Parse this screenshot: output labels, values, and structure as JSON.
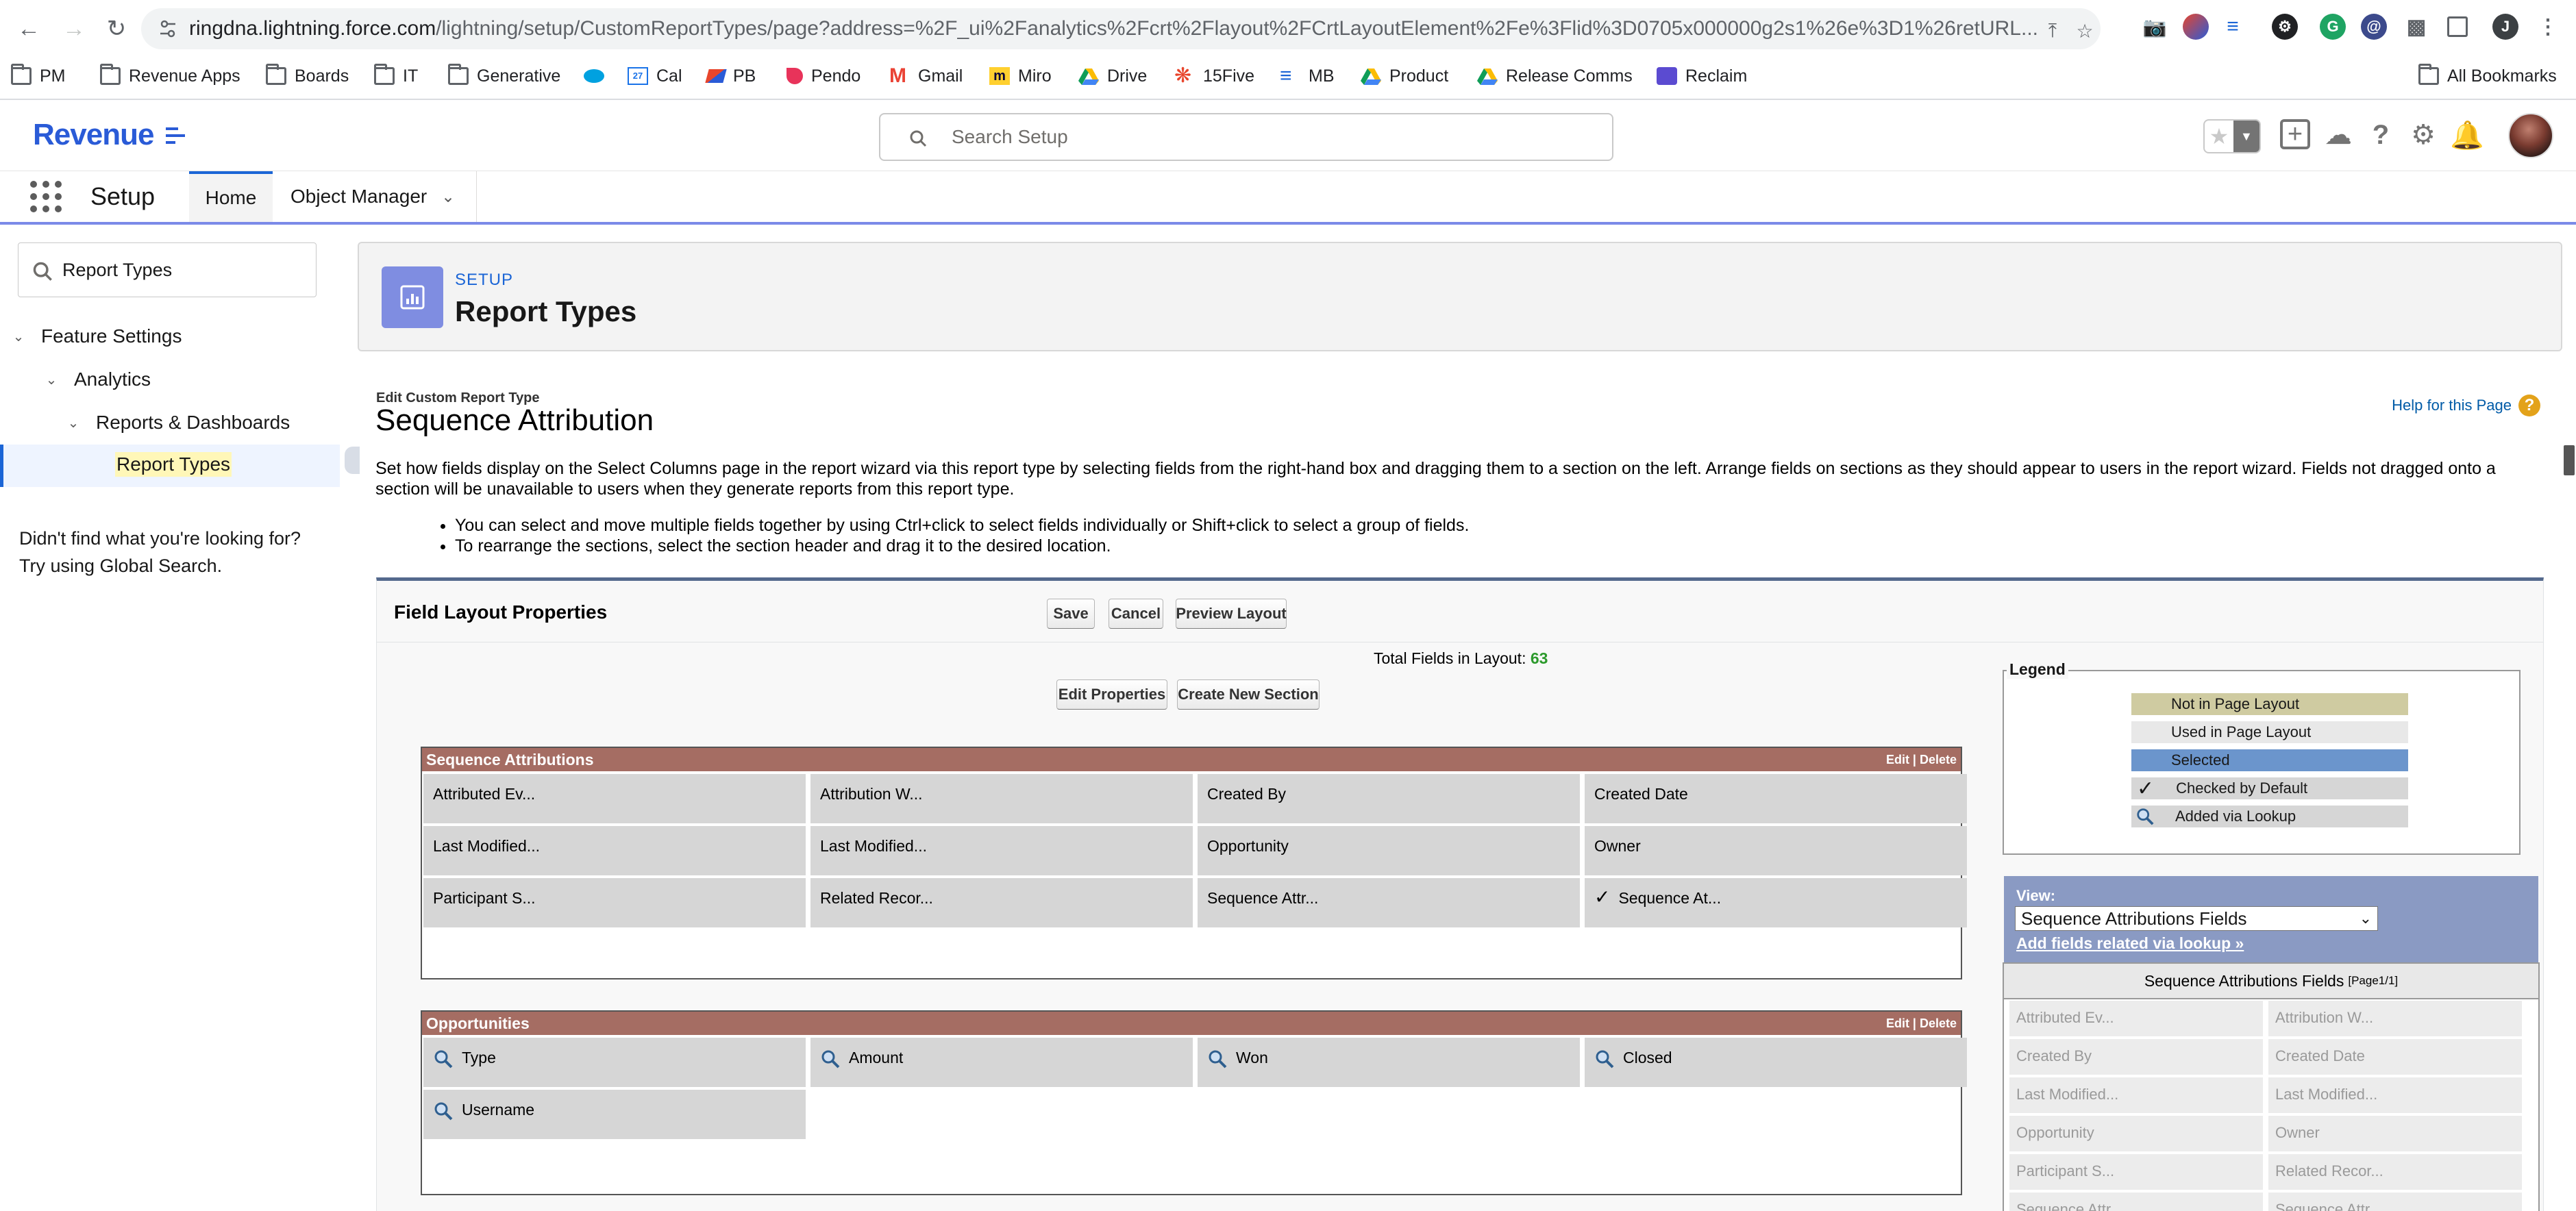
{
  "browser": {
    "url_host": "ringdna.lightning.force.com",
    "url_path": "/lightning/setup/CustomReportTypes/page?address=%2F_ui%2Fanalytics%2Fcrt%2Flayout%2FCrtLayoutElement%2Fe%3Flid%3D0705x000000g2s1%26e%3D1%26retURL...",
    "profile_initial": "J",
    "bookmarks": [
      "PM",
      "Revenue Apps",
      "Boards",
      "IT",
      "Generative",
      "Cal",
      "PB",
      "Pendo",
      "Gmail",
      "Miro",
      "Drive",
      "15Five",
      "MB",
      "Product",
      "Release Comms",
      "Reclaim"
    ],
    "all_bookmarks": "All Bookmarks",
    "cal_badge": "27"
  },
  "sf": {
    "logo": "Revenue",
    "search_placeholder": "Search Setup",
    "app_name": "Setup",
    "tabs": {
      "home": "Home",
      "object_manager": "Object Manager"
    }
  },
  "sidebar": {
    "quickfind_value": "Report Types",
    "tree": [
      "Feature Settings",
      "Analytics",
      "Reports & Dashboards",
      "Report Types"
    ],
    "not_found_line1": "Didn't find what you're looking for?",
    "not_found_line2": "Try using Global Search."
  },
  "page_header": {
    "eyebrow": "SETUP",
    "title": "Report Types"
  },
  "content": {
    "edit_label": "Edit Custom Report Type",
    "title": "Sequence Attribution",
    "help_link": "Help for this Page",
    "instructions": "Set how fields display on the Select Columns page in the report wizard via this report type by selecting fields from the right-hand box and dragging them to a section on the left. Arrange fields on sections as they should appear to users in the report wizard. Fields not dragged onto a section will be unavailable to users when they generate reports from this report type.",
    "bullets": [
      "You can select and move multiple fields together by using Ctrl+click to select fields individually or Shift+click to select a group of fields.",
      "To rearrange the sections, select the section header and drag it to the desired location."
    ]
  },
  "layout": {
    "title": "Field Layout Properties",
    "buttons": {
      "save": "Save",
      "cancel": "Cancel",
      "preview": "Preview Layout",
      "edit_properties": "Edit Properties",
      "create_section": "Create New Section"
    },
    "total_label": "Total Fields in Layout:",
    "total_value": "63",
    "section_actions": "Edit | Delete",
    "sections": [
      {
        "name": "Sequence Attributions",
        "fields": [
          "Attributed Ev...",
          "Attribution W...",
          "Created By",
          "Created Date",
          "Last Modified...",
          "Last Modified...",
          "Opportunity",
          "Owner",
          "Participant S...",
          "Related Recor...",
          "Sequence Attr...",
          "Sequence At..."
        ]
      },
      {
        "name": "Opportunities",
        "fields": [
          "Type",
          "Amount",
          "Won",
          "Closed",
          "Username"
        ]
      }
    ],
    "legend": {
      "title": "Legend",
      "items": [
        "Not in Page Layout",
        "Used in Page Layout",
        "Selected",
        "Checked by Default",
        "Added via Lookup"
      ],
      "colors": [
        "#cfcba1",
        "#e8e8e8",
        "#6b95cc",
        "#d6d6d6",
        "#d6d6d6"
      ]
    },
    "view": {
      "label": "View:",
      "selected": "Sequence Attributions Fields",
      "lookup_link": "Add fields related via lookup »"
    },
    "available": {
      "title": "Sequence Attributions Fields",
      "page": "[Page1/1]",
      "fields": [
        "Attributed Ev...",
        "Attribution W...",
        "Created By",
        "Created Date",
        "Last Modified...",
        "Last Modified...",
        "Opportunity",
        "Owner",
        "Participant S...",
        "Related Recor...",
        "Sequence Attr...",
        "Sequence Attr..."
      ]
    }
  }
}
